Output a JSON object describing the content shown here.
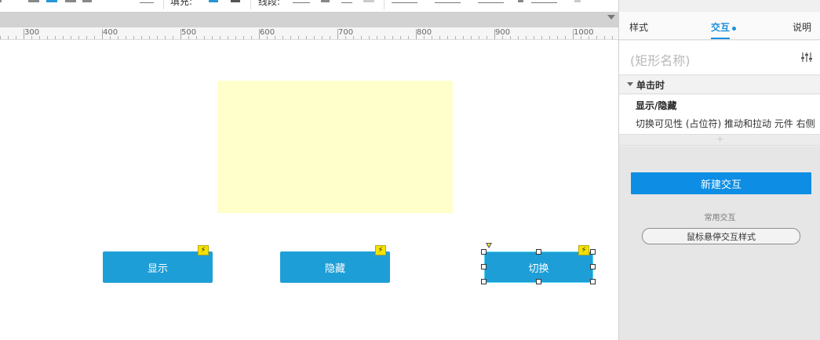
{
  "toolbar": {
    "fill_label": "填充:",
    "border_label": "线段:"
  },
  "ruler": {
    "labels": [
      "300",
      "400",
      "500",
      "600",
      "700",
      "800",
      "900",
      "1000"
    ]
  },
  "canvas": {
    "buttons": {
      "show": "显示",
      "hide": "隐藏",
      "toggle": "切换"
    },
    "interaction_badge_icon": "lightning-icon"
  },
  "panel": {
    "tabs": {
      "style": "样式",
      "interaction": "交互",
      "notes": "说明"
    },
    "name_placeholder": "(矩形名称)",
    "event": {
      "label": "单击时",
      "case_name": "显示/隐藏",
      "action": "切换可见性 (占位符) 推动和拉动 元件 右侧"
    },
    "new_interaction_button": "新建交互",
    "common_label": "常用交互",
    "hover_style_button": "鼠标悬停交互样式"
  },
  "colors": {
    "accent": "#1a8fe0",
    "widget_button": "#1e9ed7",
    "dynamic_panel_fill": "#ffffcc",
    "badge": "#f5e200"
  }
}
